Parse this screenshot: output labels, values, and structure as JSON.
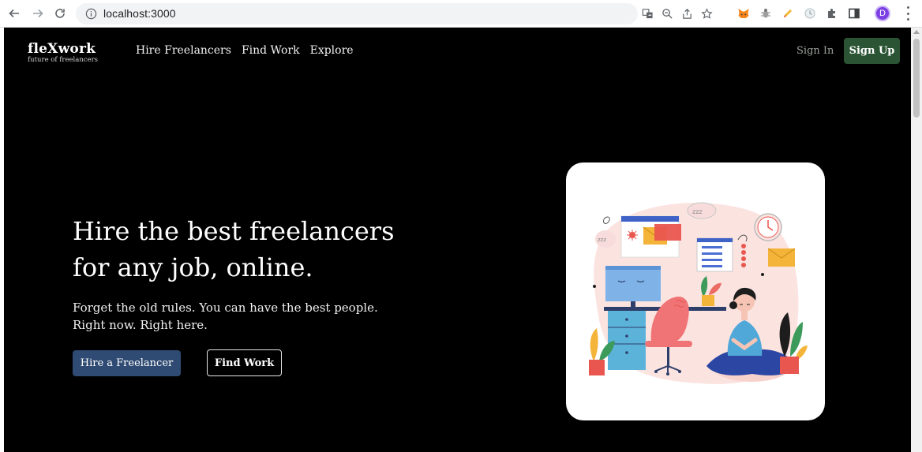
{
  "browser": {
    "url": "localhost:3000",
    "profile_initial": "D",
    "toolbar_icons": [
      "translate-icon",
      "zoom-icon",
      "share-icon",
      "bookmark-star-icon"
    ],
    "extensions": [
      "metamask-fox-icon",
      "bug-extension-icon",
      "pen-extension-icon",
      "clock-extension-icon",
      "puzzle-extensions-icon",
      "side-panel-icon"
    ]
  },
  "brand": {
    "name": "fleXwork",
    "tagline": "future of freelancers"
  },
  "nav": {
    "links": [
      "Hire Freelancers",
      "Find Work",
      "Explore"
    ],
    "sign_in": "Sign In",
    "sign_up": "Sign Up"
  },
  "hero": {
    "headline_line1": "Hire the best freelancers",
    "headline_line2": "for any job, online.",
    "subtext": "Forget the old rules. You can have the best people. Right now. Right here.",
    "primary_cta": "Hire a Freelancer",
    "secondary_cta": "Find Work"
  },
  "illustration": {
    "speech_bubble_text": "zzz",
    "left_bubble_text": "zzz"
  },
  "colors": {
    "page_background": "#000000",
    "sign_up_button": "#2b5434",
    "primary_button": "#2f4b73",
    "sign_in_text": "#9aa19a",
    "profile_avatar": "#7b3fe4"
  }
}
